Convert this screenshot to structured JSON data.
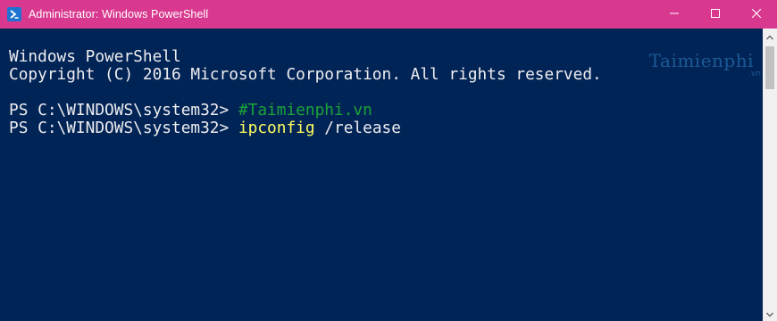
{
  "window": {
    "title": "Administrator: Windows PowerShell",
    "accent_color": "#d8398f",
    "background_color": "#012456",
    "icon": "powershell-icon",
    "controls": {
      "minimize": "minimize-icon",
      "maximize": "maximize-icon",
      "close": "close-icon"
    }
  },
  "console": {
    "header_line1": "Windows PowerShell",
    "header_line2": "Copyright (C) 2016 Microsoft Corporation. All rights reserved.",
    "prompt1": "PS C:\\WINDOWS\\system32> ",
    "comment": "#Taimienphi.vn",
    "prompt2": "PS C:\\WINDOWS\\system32> ",
    "command": "ipconfig",
    "argument": " /release"
  },
  "watermark": {
    "text": "Taimienphi",
    "suffix": ".vn"
  }
}
